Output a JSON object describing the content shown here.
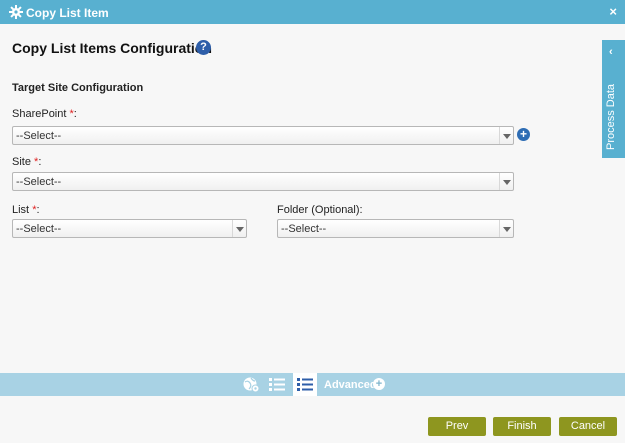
{
  "window": {
    "title": "Copy List Item",
    "close_glyph": "×"
  },
  "heading": {
    "text": "Copy List Items Configuration",
    "help_glyph": "?"
  },
  "section_title": "Target Site Configuration",
  "fields": {
    "sharepoint": {
      "label": "SharePoint",
      "required": "*",
      "suffix": ":",
      "value": "--Select--",
      "add_glyph": "+"
    },
    "site": {
      "label": "Site",
      "required": "*",
      "suffix": ":",
      "value": "--Select--"
    },
    "list": {
      "label": "List",
      "required": "*",
      "suffix": ":",
      "value": "--Select--"
    },
    "folder": {
      "label": "Folder (Optional):",
      "value": "--Select--"
    }
  },
  "side_tab": {
    "label": "Process Data",
    "chevron": "‹"
  },
  "bottom_bar": {
    "advanced_label": "Advanced",
    "plus_glyph": "+"
  },
  "buttons": {
    "prev": "Prev",
    "finish": "Finish",
    "cancel": "Cancel"
  },
  "colors": {
    "titlebar": "#58b0d0",
    "bottombar": "#a8d2e4",
    "button": "#8e961f",
    "required": "#e02020",
    "help": "#2e5ea9"
  },
  "icons": [
    "gear-icon",
    "close-icon",
    "help-icon",
    "chevron-left-icon",
    "add-icon",
    "globe-settings-icon",
    "list-icon",
    "list-active-icon",
    "plus-circle-icon"
  ]
}
